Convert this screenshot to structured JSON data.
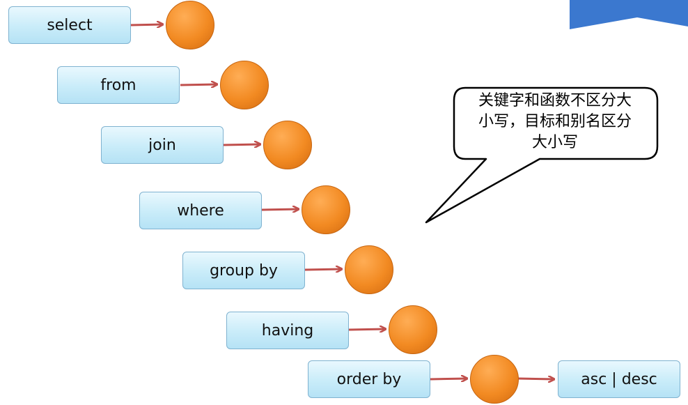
{
  "steps": [
    {
      "label": "select"
    },
    {
      "label": "from"
    },
    {
      "label": "join"
    },
    {
      "label": "where"
    },
    {
      "label": "group by"
    },
    {
      "label": "having"
    },
    {
      "label": "order by"
    }
  ],
  "final_step": {
    "label": "asc | desc"
  },
  "callout": {
    "line1": "关键字和函数不区分大",
    "line2": "小写，目标和别名区分",
    "line3": "大小写"
  },
  "colors": {
    "box_border": "#7fb2d0",
    "box_fill": "#c9ecf9",
    "ball": "#f28a22",
    "arrow": "#c0504d",
    "corner_accent": "#3b78cf"
  }
}
